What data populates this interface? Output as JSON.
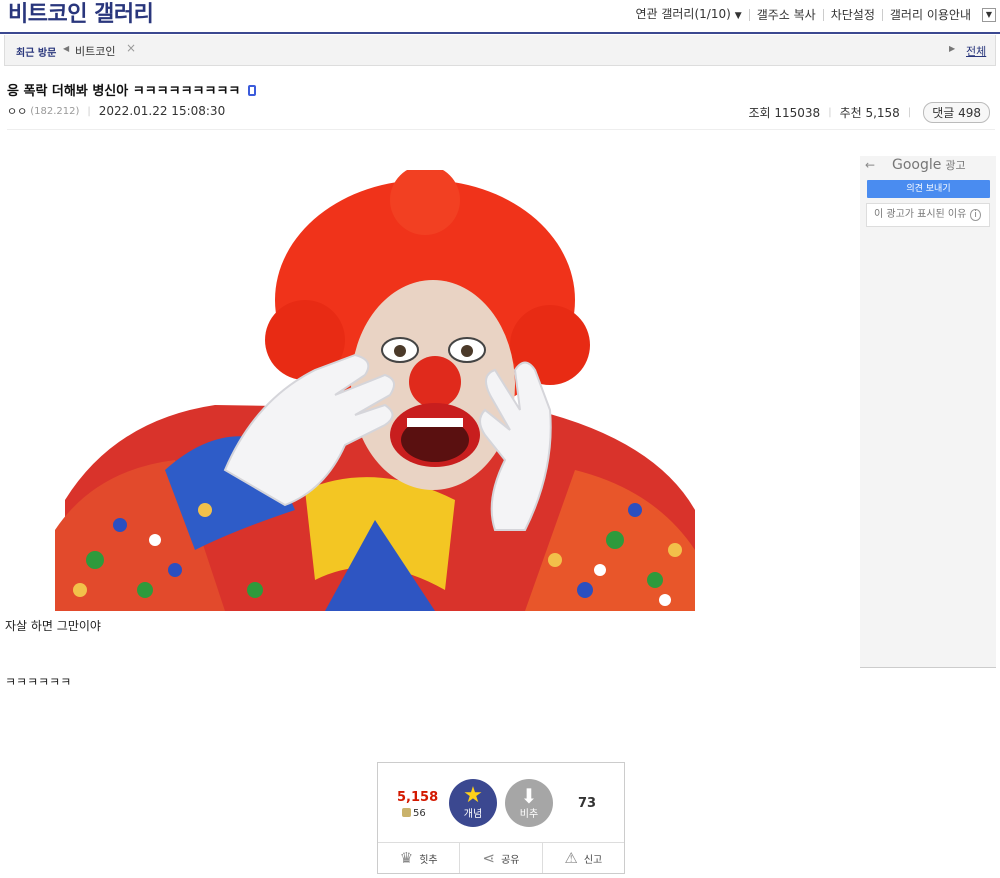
{
  "header": {
    "gallery_title": "비트코인 갤러리",
    "links": {
      "related": "연관 갤러리(1/10)",
      "copy_address": "갤주소 복사",
      "block_settings": "차단설정",
      "guide": "갤러리 이용안내"
    }
  },
  "recent": {
    "label": "최근 방문",
    "item": "비트코인",
    "close": "×",
    "all": "전체"
  },
  "post": {
    "title": "응 폭락 더해봐 병신아 ㅋㅋㅋㅋㅋㅋㅋㅋㅋ",
    "writer": "ㅇㅇ",
    "ip": "(182.212)",
    "date": "2022.01.22 15:08:30",
    "views": "조회 115038",
    "recommend": "추천 5,158",
    "comments": "댓글 498",
    "body": [
      "자살 하면 그만이야",
      "ㅋㅋㅋㅋㅋㅋ"
    ]
  },
  "ad": {
    "back": "←",
    "google": "Google",
    "ad_label": "광고",
    "feedback": "의견 보내기",
    "why": "이 광고가 표시된 이유",
    "info": "i"
  },
  "vote": {
    "up_count": "5,158",
    "fixed_count": "56",
    "up_label": "개념",
    "down_label": "비추",
    "down_count": "73",
    "actions": {
      "hit": "힛추",
      "share": "공유",
      "report": "신고"
    }
  },
  "icons": {
    "mobile": "mobile-icon",
    "star": "star-icon",
    "down": "arrow-down-icon",
    "crown": "crown-icon",
    "share": "share-icon",
    "siren": "siren-icon"
  },
  "colors": {
    "brand": "#3b4890",
    "recommend_red": "#d31900",
    "ad_blue": "#4a8cf0"
  }
}
